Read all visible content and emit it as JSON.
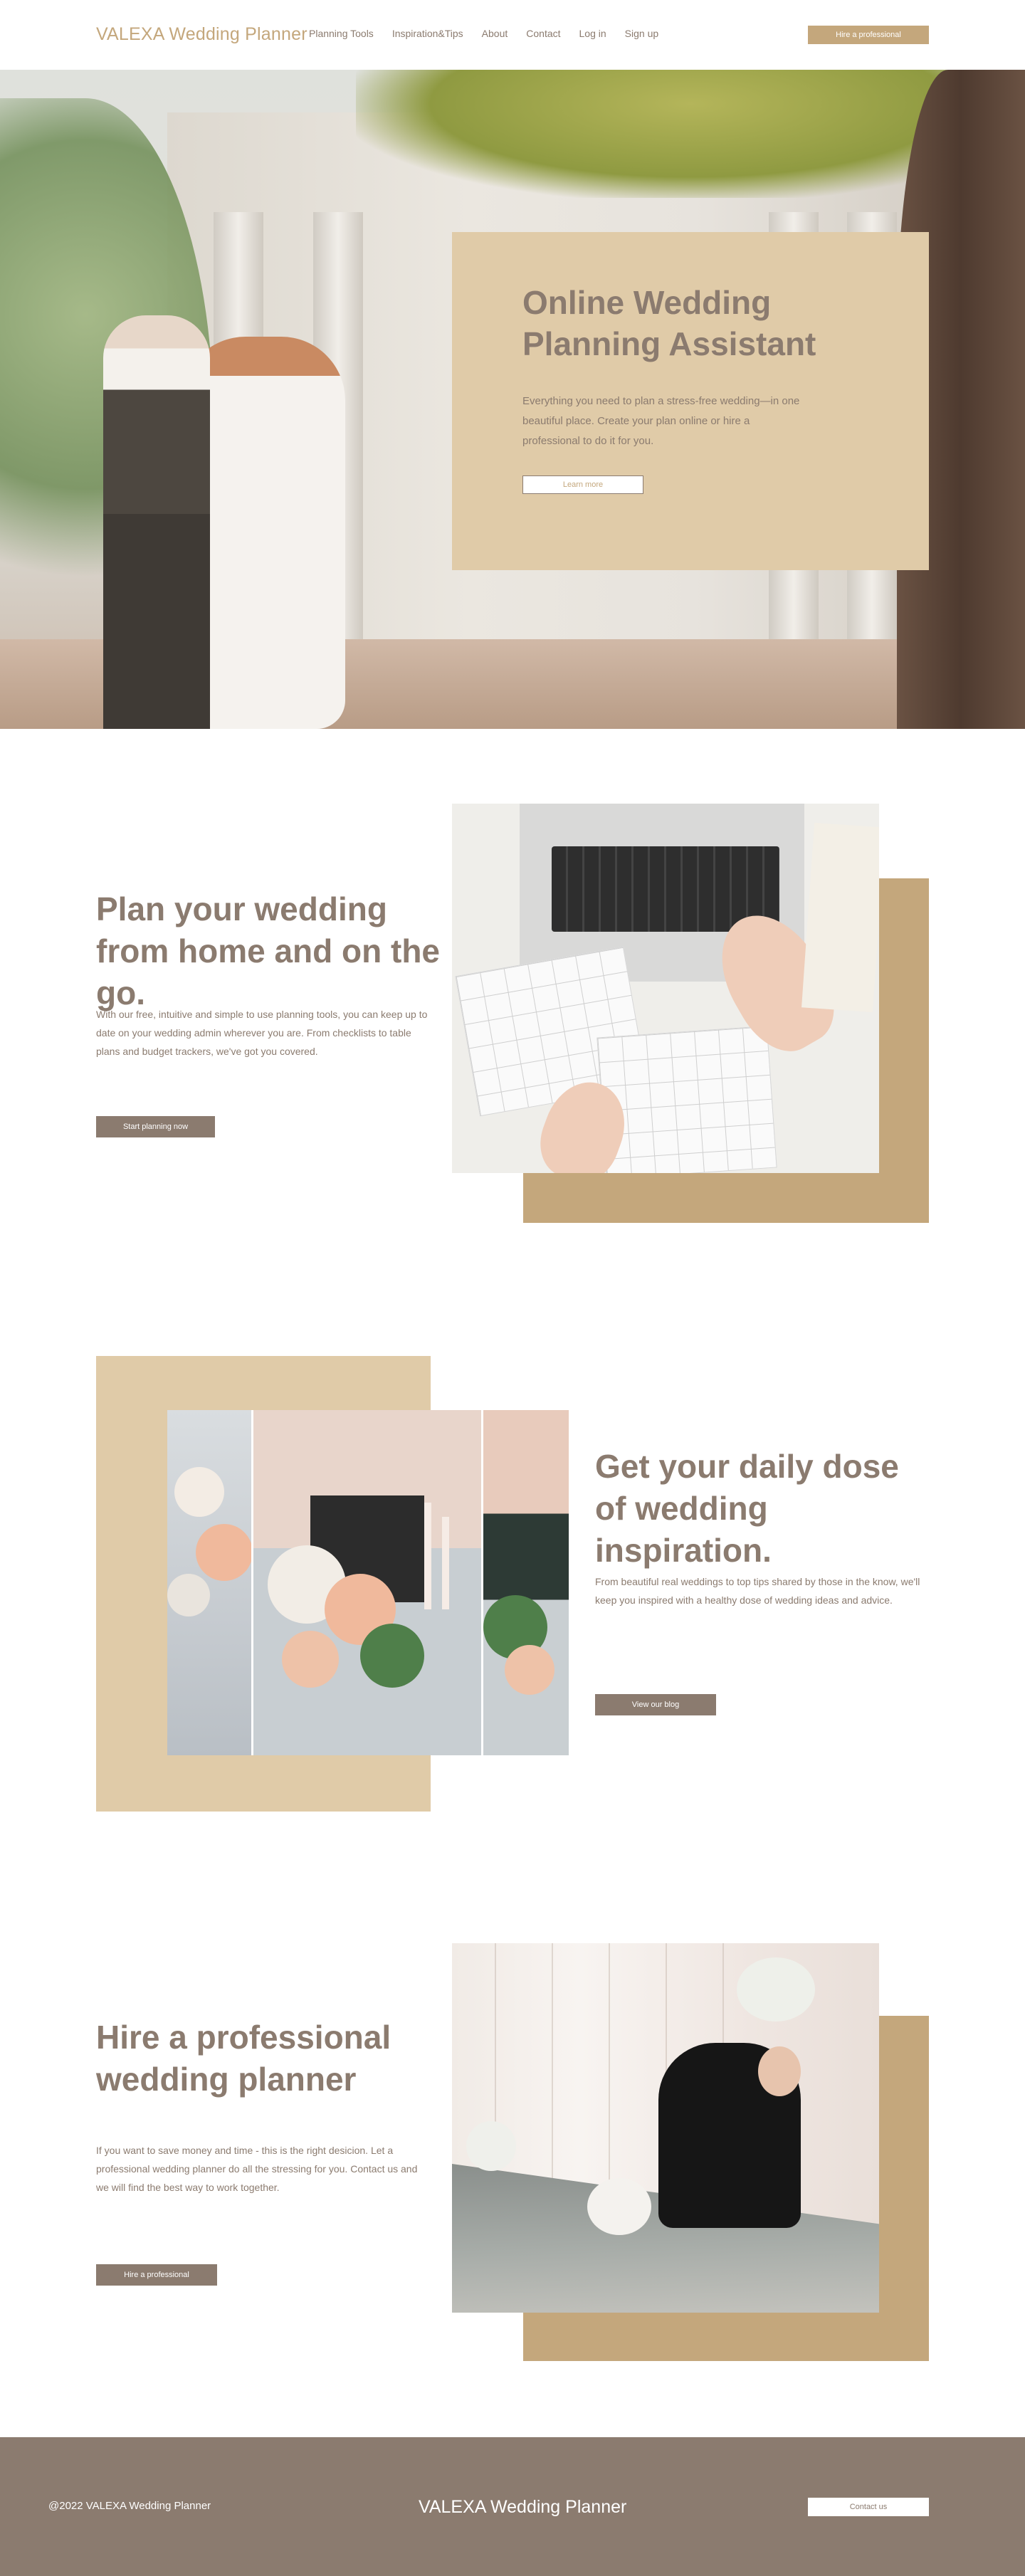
{
  "header": {
    "logo": "VALEXA Wedding Planner",
    "nav": [
      "Planning Tools",
      "Inspiration&Tips",
      "About",
      "Contact",
      "Log in",
      "Sign up"
    ],
    "cta": "Hire a professional"
  },
  "hero": {
    "title": "Online Wedding Planning Assistant",
    "text": "Everything you need to plan a stress-free wedding—in one beautiful place. Create your plan online or hire a professional to do it for you.",
    "button": "Learn more"
  },
  "section_plan": {
    "title": "Plan your wedding from home and on the go.",
    "text": "With our free, intuitive and simple to use planning tools, you can keep up to date on your wedding admin wherever you are. From checklists to table plans and budget trackers, we've got you covered.",
    "button": "Start planning now"
  },
  "section_inspiration": {
    "title": "Get your daily dose of wedding inspiration.",
    "text": "From beautiful real weddings to top tips shared by those in the know, we'll keep you inspired with a healthy dose of wedding ideas and advice.",
    "button": "View our blog"
  },
  "section_hire": {
    "title": "Hire a professional wedding planner",
    "text": "If you want to save money and time - this is the right desicion. Let a professional wedding planner do all the stressing for you. Contact us and we will find the best way to work together.",
    "button": "Hire a professional"
  },
  "footer": {
    "copyright": "@2022 VALEXA Wedding Planner",
    "logo": "VALEXA Wedding Planner",
    "button": "Contact us"
  },
  "colors": {
    "accent_gold": "#c4a77c",
    "beige": "#e0cba8",
    "taupe": "#8b7b6f",
    "background": "#ffffff"
  }
}
